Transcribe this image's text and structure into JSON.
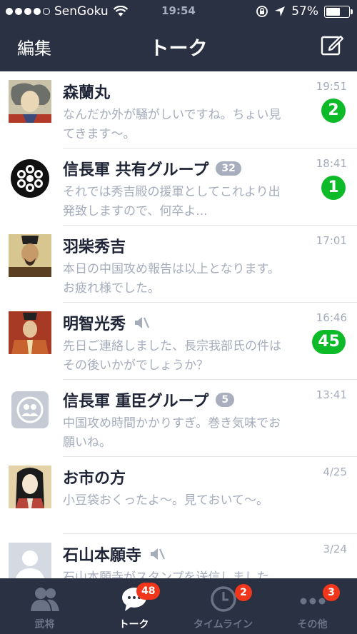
{
  "status": {
    "carrier": "SenGoku",
    "time": "19:54",
    "battery": "57%"
  },
  "nav": {
    "edit_label": "編集",
    "title": "トーク"
  },
  "chats": [
    {
      "name": "森蘭丸",
      "group_count": "",
      "muted": false,
      "time": "19:51",
      "unread": "2",
      "preview": "なんだか外が騒がしいですね。ちょい見てきます〜。"
    },
    {
      "name": "信長軍 共有グループ",
      "group_count": "32",
      "muted": false,
      "time": "18:41",
      "unread": "1",
      "preview": "それでは秀吉殿の援軍としてこれより出発致しますので、何卒よ..."
    },
    {
      "name": "羽柴秀吉",
      "group_count": "",
      "muted": false,
      "time": "17:01",
      "unread": "",
      "preview": "本日の中国攻め報告は以上となります。お疲れ様でした。"
    },
    {
      "name": "明智光秀",
      "group_count": "",
      "muted": true,
      "time": "16:46",
      "unread": "45",
      "preview": "先日ご連絡しました、長宗我部氏の件はその後いかがでしょうか？"
    },
    {
      "name": "信長軍 重臣グループ",
      "group_count": "5",
      "muted": false,
      "time": "13:41",
      "unread": "",
      "preview": "中国攻め時間かかりすぎ。巻き気味でお願いね。"
    },
    {
      "name": "お市の方",
      "group_count": "",
      "muted": false,
      "time": "4/25",
      "unread": "",
      "preview": "小豆袋おくったよ〜。見ておいて〜。"
    },
    {
      "name": "石山本願寺",
      "group_count": "",
      "muted": true,
      "time": "3/24",
      "unread": "",
      "preview": "石山本願寺がスタンプを送信しました"
    }
  ],
  "tabs": [
    {
      "label": "武将",
      "badge": ""
    },
    {
      "label": "トーク",
      "badge": "48"
    },
    {
      "label": "タイムライン",
      "badge": "2"
    },
    {
      "label": "その他",
      "badge": "3"
    }
  ],
  "colors": {
    "nav_bg": "#2a3143",
    "unread_green": "#0dbb29",
    "badge_red": "#f0371c"
  }
}
